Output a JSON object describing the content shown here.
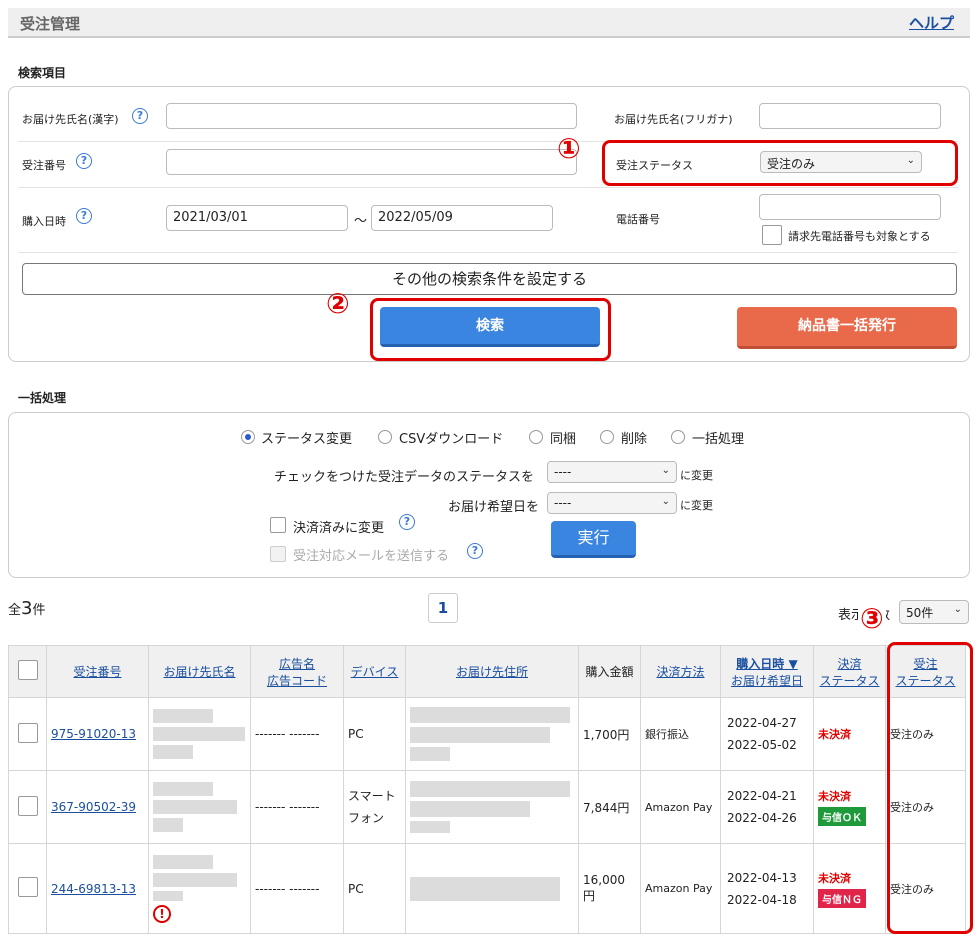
{
  "header": {
    "title": "受注管理",
    "help": "ヘルプ"
  },
  "search": {
    "section_label": "検索項目",
    "name_kanji_label": "お届け先氏名(漢字)",
    "name_kana_label": "お届け先氏名(フリガナ)",
    "order_no_label": "受注番号",
    "order_status_label": "受注ステータス",
    "order_status_value": "受注のみ",
    "purchase_date_label": "購入日時",
    "date_from": "2021/03/01",
    "date_sep": "～",
    "date_to": "2022/05/09",
    "phone_label": "電話番号",
    "billing_phone_label": "請求先電話番号も対象とする",
    "more_conditions": "その他の検索条件を設定する",
    "search_button": "検索",
    "bulk_invoice_button": "納品書一括発行",
    "help_glyph": "?"
  },
  "annotations": {
    "one": "①",
    "two": "②",
    "three": "③"
  },
  "bulk": {
    "section_label": "一括処理",
    "radios": [
      "ステータス変更",
      "CSVダウンロード",
      "同梱",
      "削除",
      "一括処理"
    ],
    "status_row_label": "チェックをつけた受注データのステータスを",
    "status_select": "----",
    "change_suffix": "に変更",
    "delivery_row_label": "お届け希望日を",
    "delivery_select": "----",
    "paid_label": "決済済みに変更",
    "mail_label": "受注対応メールを送信する",
    "execute_button": "実行"
  },
  "results": {
    "total_prefix": "全",
    "total_count": "3",
    "total_suffix": "件",
    "page": "1",
    "display_label": "表示件数",
    "per_page": "50件"
  },
  "table": {
    "headers": {
      "order_no": "受注番号",
      "name": "お届け先氏名",
      "ad_line1": "広告名",
      "ad_line2": "広告コード",
      "device": "デバイス",
      "address": "お届け先住所",
      "amount": "購入金額",
      "payment": "決済方法",
      "date_line1": "購入日時 ▼",
      "date_line2": "お届け希望日",
      "pay_status_line1": "決済",
      "pay_status_line2": "ステータス",
      "order_status_line1": "受注",
      "order_status_line2": "ステータス"
    },
    "rows": [
      {
        "order_no": "975-91020-13",
        "ad": "------- -------",
        "device": "PC",
        "amount": "1,700円",
        "payment": "銀行振込",
        "purchase": "2022-04-27",
        "delivery": "2022-05-02",
        "pay_status": "未決済",
        "credit": "",
        "order_status": "受注のみ"
      },
      {
        "order_no": "367-90502-39",
        "ad": "------- -------",
        "device": "スマート\nフォン",
        "amount": "7,844円",
        "payment": "Amazon Pay",
        "purchase": "2022-04-21",
        "delivery": "2022-04-26",
        "pay_status": "未決済",
        "credit": "与信ＯＫ",
        "order_status": "受注のみ"
      },
      {
        "order_no": "244-69813-13",
        "ad": "------- -------",
        "device": "PC",
        "amount": "16,000円",
        "payment": "Amazon Pay",
        "purchase": "2022-04-13",
        "delivery": "2022-04-18",
        "pay_status": "未決済",
        "credit": "与信ＮＧ",
        "order_status": "受注のみ"
      }
    ]
  },
  "colors": {
    "link": "#1a4fa0",
    "primary": "#3a85e0",
    "danger": "#e86a4a",
    "highlight": "#e00000",
    "ok": "#1f9a3a",
    "ng": "#e0244a"
  }
}
